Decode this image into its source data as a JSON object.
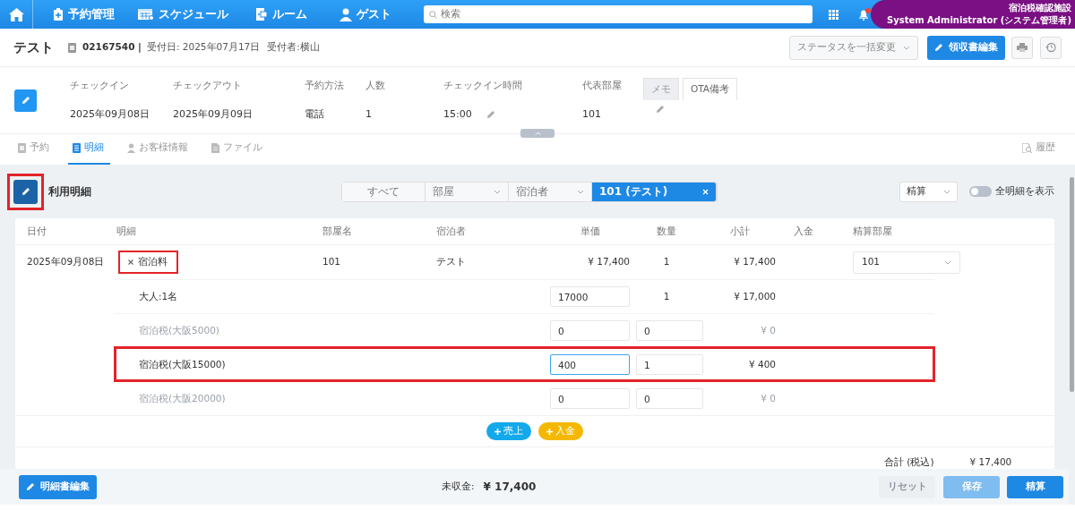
{
  "navbar": {
    "items": [
      {
        "label": "予約管理"
      },
      {
        "label": "スケジュール"
      },
      {
        "label": "ルーム"
      },
      {
        "label": "ゲスト"
      }
    ],
    "search": {
      "placeholder": "検索"
    },
    "notification": true,
    "user": {
      "facility": "宿泊税確認施設",
      "name": "System Administrator (システム管理者)"
    }
  },
  "header": {
    "title": "テスト",
    "number": "02167540 |",
    "received_date": "受付日: 2025年07月17日",
    "receiver": "受付者:横山",
    "status_select": {
      "placeholder": "ステータスを一括変更"
    },
    "receipt_button": "領収書編集"
  },
  "info": {
    "fields": [
      {
        "label": "チェックイン",
        "value": "2025年09月08日",
        "editable": false
      },
      {
        "label": "チェックアウト",
        "value": "2025年09月09日",
        "editable": false
      },
      {
        "label": "予約方法",
        "value": "電話",
        "editable": false
      },
      {
        "label": "人数",
        "value": "1",
        "editable": false
      },
      {
        "label": "チェックイン時間",
        "value": "15:00",
        "editable": true
      },
      {
        "label": "代表部屋",
        "value": "101",
        "editable": false
      }
    ],
    "memo_tabs": [
      {
        "label": "メモ",
        "selected": false
      },
      {
        "label": "OTA備考",
        "selected": true
      }
    ]
  },
  "tabs": [
    {
      "label": "予約",
      "selected": false
    },
    {
      "label": "明細",
      "selected": true
    },
    {
      "label": "お客様情報",
      "selected": false
    },
    {
      "label": "ファイル",
      "selected": false
    }
  ],
  "history_link": "履歴",
  "details": {
    "title": "利用明細",
    "edit_highlighted": true,
    "filters": [
      {
        "kind": "button",
        "label": "すべて"
      },
      {
        "kind": "select",
        "label": "部屋"
      },
      {
        "kind": "select",
        "label": "宿泊者"
      },
      {
        "kind": "chip",
        "label": "101 (テスト)"
      }
    ],
    "settle_select": "精算",
    "show_all": {
      "label": "全明細を表示",
      "on": false
    },
    "columns": [
      "日付",
      "明細",
      "部屋名",
      "宿泊者",
      "単価",
      "数量",
      "小計",
      "入金",
      "精算部屋"
    ],
    "row": {
      "date": "2025年09月08日",
      "item": "宿泊料",
      "item_highlighted": true,
      "room": "101",
      "guest": "テスト",
      "price": "¥ 17,400",
      "qty": "1",
      "subtotal": "¥ 17,400",
      "settle_room": "101"
    },
    "sub_rows": [
      {
        "kind": "price_input",
        "label": "大人:1名",
        "price": "17000",
        "qty": "1",
        "subtotal": "¥ 17,000",
        "enabled": true,
        "highlighted": false,
        "focused": false
      },
      {
        "kind": "both_inputs",
        "label": "宿泊税(大阪5000)",
        "price": "0",
        "qty": "0",
        "subtotal": "¥ 0",
        "enabled": false,
        "highlighted": false,
        "focused": false
      },
      {
        "kind": "both_inputs",
        "label": "宿泊税(大阪15000)",
        "price": "400",
        "qty": "1",
        "subtotal": "¥ 400",
        "enabled": true,
        "highlighted": true,
        "focused": true
      },
      {
        "kind": "both_inputs",
        "label": "宿泊税(大阪20000)",
        "price": "0",
        "qty": "0",
        "subtotal": "¥ 0",
        "enabled": false,
        "highlighted": false,
        "focused": false
      }
    ],
    "add_buttons": [
      {
        "kind": "sales",
        "label": "売上"
      },
      {
        "kind": "deposit",
        "label": "入金"
      }
    ],
    "total_label": "合計 (税込)",
    "total_value": "¥ 17,400"
  },
  "footer": {
    "edit_button": "明細書編集",
    "unpaid_label": "未収金:",
    "unpaid_value": "¥ 17,400",
    "buttons": [
      {
        "kind": "reset",
        "label": "リセット"
      },
      {
        "kind": "save",
        "label": "保存"
      },
      {
        "kind": "settle",
        "label": "精算"
      }
    ]
  }
}
